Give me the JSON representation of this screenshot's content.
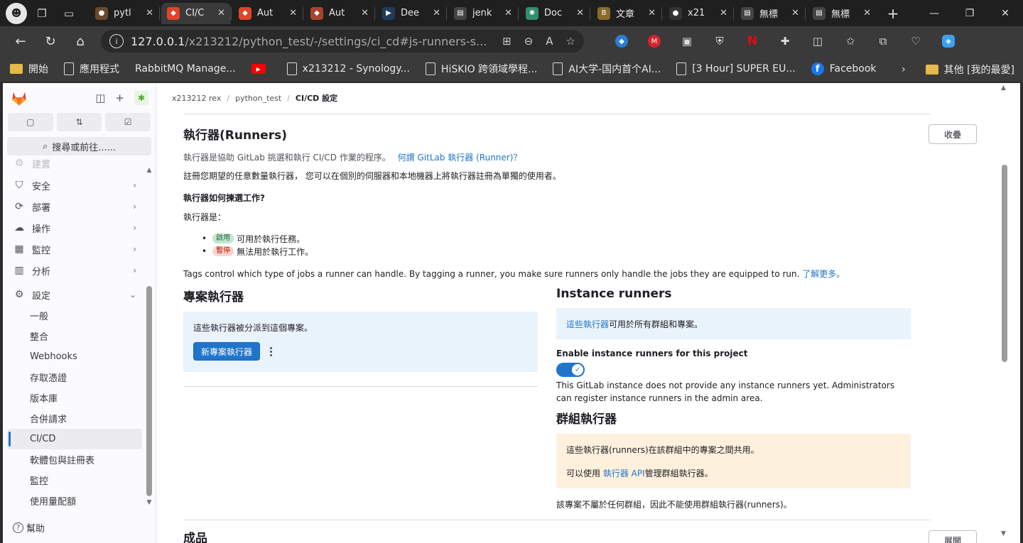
{
  "browser": {
    "tabs": [
      {
        "label": "pytl",
        "fav_color": "#6b4a2b",
        "fav_text": "●"
      },
      {
        "label": "CI/C",
        "fav_color": "#e24329",
        "fav_text": "◆"
      },
      {
        "label": "Aut",
        "fav_color": "#e24329",
        "fav_text": "◆"
      },
      {
        "label": "Aut",
        "fav_color": "#a8432c",
        "fav_text": "◆"
      },
      {
        "label": "Dee",
        "fav_color": "#1f3c5c",
        "fav_text": "▶"
      },
      {
        "label": "jenk",
        "fav_color": "#444",
        "fav_text": "▤"
      },
      {
        "label": "Doc",
        "fav_color": "#2f8f6e",
        "fav_text": "✺"
      },
      {
        "label": "文章",
        "fav_color": "#8a6a2a",
        "fav_text": "B"
      },
      {
        "label": "x21",
        "fav_color": "#333",
        "fav_text": "●"
      },
      {
        "label": "無標",
        "fav_color": "#444",
        "fav_text": "▤"
      },
      {
        "label": "無標",
        "fav_color": "#444",
        "fav_text": "▤"
      }
    ],
    "url_host": "127.0.0.1",
    "url_path": "/x213212/python_test/-/settings/ci_cd#js-runners-s...",
    "bookmarks": [
      {
        "label": "開始",
        "kind": "folder"
      },
      {
        "label": "應用程式",
        "kind": "doc"
      },
      {
        "label": "RabbitMQ Manage...",
        "kind": "none"
      },
      {
        "label": "",
        "kind": "youtube"
      },
      {
        "label": "x213212 - Synology...",
        "kind": "doc"
      },
      {
        "label": "HiSKIO 跨領域學程...",
        "kind": "doc"
      },
      {
        "label": "AI大学-国内首个AI...",
        "kind": "doc"
      },
      {
        "label": "[3 Hour] SUPER EU...",
        "kind": "doc"
      },
      {
        "label": "Facebook",
        "kind": "facebook"
      }
    ],
    "bookmarks_other": "其他 [我的最愛]"
  },
  "sidebar": {
    "counters": [
      "▢",
      "⇅",
      "☑"
    ],
    "search_label": "搜尋或前往......",
    "faded_item": "建置",
    "items": [
      {
        "label": "安全",
        "icon": "shield-icon",
        "glyph": "⛉"
      },
      {
        "label": "部署",
        "icon": "deploy-icon",
        "glyph": "⟳"
      },
      {
        "label": "操作",
        "icon": "cloud-icon",
        "glyph": "☁"
      },
      {
        "label": "監控",
        "icon": "monitor-icon",
        "glyph": "▦"
      },
      {
        "label": "分析",
        "icon": "chart-icon",
        "glyph": "▥"
      }
    ],
    "settings_label": "設定",
    "sub_items": [
      "一般",
      "整合",
      "Webhooks",
      "存取憑證",
      "版本庫",
      "合併請求",
      "CI/CD",
      "軟體包與註冊表",
      "監控",
      "使用量配額"
    ],
    "help_label": "幫助"
  },
  "breadcrumb": {
    "user": "x213212 rex",
    "project": "python_test",
    "current": "CI/CD 設定"
  },
  "runners": {
    "title": "執行器(Runners)",
    "collapse_label": "收疊",
    "desc_text": "執行器是協助 GitLab 挑選和執行 CI/CD 作業的程序。",
    "desc_link": "何謂 GitLab 執行器 (Runner)？",
    "register_text": "註冊您期望的任意數量執行器， 您可以在個別的伺服器和本地機器上將執行器註冊為單獨的使用者。",
    "how_title": "執行器如何揀選工作?",
    "runners_are": "執行器是：",
    "active_badge": "啟用",
    "active_text": "可用於執行任務。",
    "paused_badge": "暫停",
    "paused_text": "無法用於執行工作。",
    "tags_text": "Tags control which type of jobs a runner can handle. By tagging a runner, you make sure runners only handle the jobs they are equipped to run.",
    "tags_link": "了解更多。"
  },
  "project_runners": {
    "title": "專案執行器",
    "info": "這些執行器被分派到這個專案。",
    "new_button": "新專案執行器"
  },
  "instance_runners": {
    "title": "Instance runners",
    "info_link": "這些執行器",
    "info_text": " 可用於所有群組和專案。",
    "enable_label": "Enable instance runners for this project",
    "note": "This GitLab instance does not provide any instance runners yet. Administrators can register instance runners in the admin area."
  },
  "group_runners": {
    "title": "群組執行器",
    "line1": "這些執行器(runners)在該群組中的專案之間共用。",
    "line2_pre": "可以使用 ",
    "line2_link": "執行器 API",
    "line2_post": "管理群組執行器。",
    "footer": "該專案不屬於任何群組，因此不能使用群組執行器(runners)。"
  },
  "next_section": {
    "title": "成品",
    "button": "展開"
  }
}
